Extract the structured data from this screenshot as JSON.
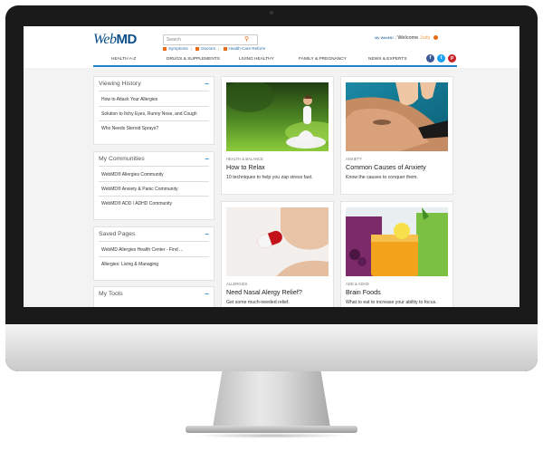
{
  "header": {
    "logo_prefix": "Web",
    "logo_suffix": "MD",
    "search_placeholder": "Search",
    "search_icon": "magnifier-icon",
    "sublinks": [
      "Symptoms",
      "Doctors",
      "Health Care Reform"
    ],
    "welcome_brand_small": "My WebMD",
    "welcome_text": "Welcome",
    "welcome_name": "Judy"
  },
  "nav": {
    "items": [
      "HEALTH A-Z",
      "DRUGS & SUPPLEMENTS",
      "LIVING HEALTHY",
      "FAMILY & PREGNANCY",
      "NEWS & EXPERTS"
    ],
    "social": [
      {
        "icon": "facebook-icon",
        "glyph": "f",
        "color": "#3b5998"
      },
      {
        "icon": "twitter-icon",
        "glyph": "t",
        "color": "#1da1f2"
      },
      {
        "icon": "pinterest-icon",
        "glyph": "p",
        "color": "#cb2027"
      }
    ]
  },
  "sidebar": {
    "panels": [
      {
        "title": "Viewing History",
        "toggle": "–",
        "items": [
          "How to Attack Your Allergies",
          "Solution to Itchy Eyes, Runny Nose, and Cough",
          "Who Needs Steroid Sprays?"
        ]
      },
      {
        "title": "My Communities",
        "toggle": "–",
        "items": [
          "WebMD® Allergies Community",
          "WebMD® Anxiety & Panic Community",
          "WebMD® ADD / ADHD Community"
        ]
      },
      {
        "title": "Saved Pages",
        "toggle": "–",
        "items": [
          "WebMD Allergies Health Center - Find ...",
          "Allergies: Living & Managing"
        ]
      },
      {
        "title": "My Tools",
        "toggle": "–",
        "items": []
      }
    ]
  },
  "cards": [
    {
      "category": "HEALTH & BALANCE",
      "title": "How to Relax",
      "description": "10 techniques to help you zap stress fast.",
      "image": "meditation-photo"
    },
    {
      "category": "ANXIETY",
      "title": "Common Causes of Anxiety",
      "description": "Know the causes to conquer them.",
      "image": "massage-photo"
    },
    {
      "category": "ALLERGIES",
      "title": "Need Nasal Alergy Relief?",
      "description": "Get some much-needed relief.",
      "image": "pill-photo"
    },
    {
      "category": "ADD & ADHD",
      "title": "Brain Foods",
      "description": "What to eat to increase your ability to focus.",
      "image": "smoothies-photo"
    }
  ],
  "colors": {
    "accent": "#1d83c6",
    "brand": "#0b4f8a",
    "orange": "#e86b18"
  }
}
